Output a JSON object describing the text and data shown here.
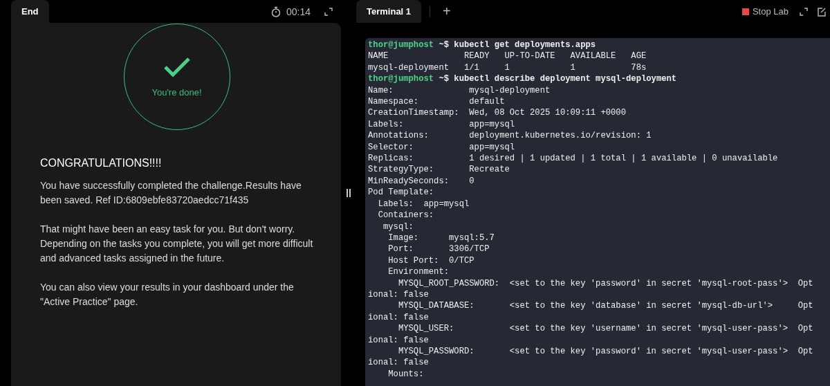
{
  "left_panel": {
    "tab": {
      "label": "End",
      "selected": true
    },
    "timer": "00:14",
    "result": {
      "message": "You're done!",
      "done": true
    },
    "heading": "CONGRATULATIONS!!!!",
    "paragraphs": [
      "You have successfully completed the challenge.Results have been saved. Ref ID:6809ebfe83720aedcc71f435",
      "That might have been an easy task for you. But don't worry. Depending on the tasks you complete, you will get more difficult and advanced tasks assigned in the future.",
      "You can also view your results in your dashboard under the \"Active Practice\" page."
    ]
  },
  "right_panel": {
    "tabs": [
      {
        "label": "Terminal 1",
        "selected": true
      }
    ],
    "add_tab": "+",
    "stop_button": "Stop Lab",
    "terminal": {
      "lines": [
        {
          "kind": "prompt",
          "user": "thor@jumphost",
          "text": " ~$ kubectl get deployments.apps"
        },
        {
          "kind": "output",
          "text": "NAME               READY   UP-TO-DATE   AVAILABLE   AGE"
        },
        {
          "kind": "output",
          "text": "mysql-deployment   1/1     1            1           78s"
        },
        {
          "kind": "prompt",
          "user": "thor@jumphost",
          "text": " ~$ kubectl describe deployment mysql-deployment"
        },
        {
          "kind": "output",
          "text": "Name:               mysql-deployment"
        },
        {
          "kind": "output",
          "text": "Namespace:          default"
        },
        {
          "kind": "output",
          "text": "CreationTimestamp:  Wed, 08 Oct 2025 10:09:11 +0000"
        },
        {
          "kind": "output",
          "text": "Labels:             app=mysql"
        },
        {
          "kind": "output",
          "text": "Annotations:        deployment.kubernetes.io/revision: 1"
        },
        {
          "kind": "output",
          "text": "Selector:           app=mysql"
        },
        {
          "kind": "output",
          "text": "Replicas:           1 desired | 1 updated | 1 total | 1 available | 0 unavailable"
        },
        {
          "kind": "output",
          "text": "StrategyType:       Recreate"
        },
        {
          "kind": "output",
          "text": "MinReadySeconds:    0"
        },
        {
          "kind": "output",
          "text": "Pod Template:"
        },
        {
          "kind": "output",
          "text": "  Labels:  app=mysql"
        },
        {
          "kind": "output",
          "text": "  Containers:"
        },
        {
          "kind": "output",
          "text": "   mysql:"
        },
        {
          "kind": "output",
          "text": "    Image:      mysql:5.7"
        },
        {
          "kind": "output",
          "text": "    Port:       3306/TCP"
        },
        {
          "kind": "output",
          "text": "    Host Port:  0/TCP"
        },
        {
          "kind": "output",
          "text": "    Environment:"
        },
        {
          "kind": "output",
          "text": "      MYSQL_ROOT_PASSWORD:  <set to the key 'password' in secret 'mysql-root-pass'>  Opt"
        },
        {
          "kind": "output",
          "text": "ional: false"
        },
        {
          "kind": "output",
          "text": "      MYSQL_DATABASE:       <set to the key 'database' in secret 'mysql-db-url'>     Opt"
        },
        {
          "kind": "output",
          "text": "ional: false"
        },
        {
          "kind": "output",
          "text": "      MYSQL_USER:           <set to the key 'username' in secret 'mysql-user-pass'>  Opt"
        },
        {
          "kind": "output",
          "text": "ional: false"
        },
        {
          "kind": "output",
          "text": "      MYSQL_PASSWORD:       <set to the key 'password' in secret 'mysql-user-pass'>  Opt"
        },
        {
          "kind": "output",
          "text": "ional: false"
        },
        {
          "kind": "output",
          "text": "    Mounts:"
        }
      ]
    }
  }
}
